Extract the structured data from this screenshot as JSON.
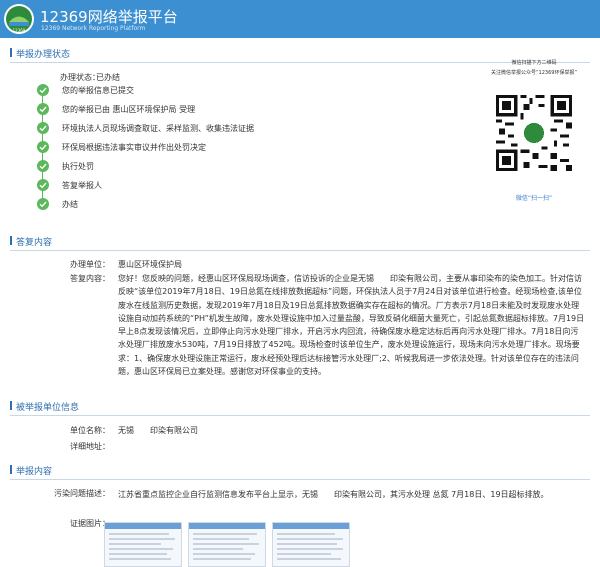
{
  "header": {
    "title": "12369网络举报平台",
    "subtitle": "12369 Network Reporting Platform",
    "logo_text": "12369",
    "colors": {
      "bar": "#3c8fd0",
      "accent": "#2f6fb0",
      "done": "#5cb85c"
    }
  },
  "status_section": {
    "title": "举报办理状态",
    "status_label": "办理状态：",
    "status_value": "已办结",
    "steps": [
      "您的举报信息已提交",
      "您的举报已由 惠山区环境保护局 受理",
      "环境执法人员现场调查取证、采样监测、收集违法证据",
      "环保局根据违法事实审议并作出处罚决定",
      "执行处罚",
      "答复举报人",
      "办结"
    ]
  },
  "qr_panel": {
    "line1": "微信扫描下方二维码",
    "line2": "关注微信举报公众号“12369环保举报”",
    "icon": "qr-code-icon",
    "footer": "微信“扫一扫”"
  },
  "reply_section": {
    "title": "答复内容",
    "unit_label": "办理单位：",
    "unit_value": "惠山区环境保护局",
    "content_label": "答复内容：",
    "content": "您好！您反映的问题，经惠山区环保局现场调查，信访投诉的企业是无锡　　印染有限公司，主要从事印染布的染色加工。针对信访反映“该单位2019年7月18日、19日总氮在线排放数据超标”问题，环保执法人员于7月24日对该单位进行检查。经现场检查,该单位废水在线监测历史数据，发现2019年7月18日及19日总氮排放数据确实存在超标的情况。厂方表示7月18日未能及时发现废水处理设施自动加药系统的“PH”机发生故障，废水处理设施中加入过量盐酸，导致反硝化细菌大量死亡，引起总氮数据超标排放。7月19日早上8点发现该情况后，立即停止向污水处理厂排水，开启污水内回流，待确保废水稳定达标后再向污水处理厂排水。7月18日向污水处理厂排放废水530吨，7月19日排放了452吨。现场检查时该单位生产，废水处理设施运行，现场未向污水处理厂排水。现场要求：1、确保废水处理设施正常运行，废水经预处理后达标接管污水处理厂;2、听候我局进一步依法处理。针对该单位存在的违法问题，惠山区环保局已立案处理。感谢您对环保事业的支持。"
  },
  "reported_section": {
    "title": "被举报单位信息",
    "name_label": "单位名称：",
    "name_value": "无锡　　印染有限公司",
    "address_label": "详细地址：",
    "address_value": ""
  },
  "report_section": {
    "title": "举报内容",
    "desc_label": "污染问题描述：",
    "desc_value": "江苏省重点监控企业自行监测信息发布平台上显示，无锡　　印染有限公司，其污水处理 总氮 7月18日、19日超标排放。",
    "evidence_label": "证据图片：",
    "evidence_count": 3
  }
}
